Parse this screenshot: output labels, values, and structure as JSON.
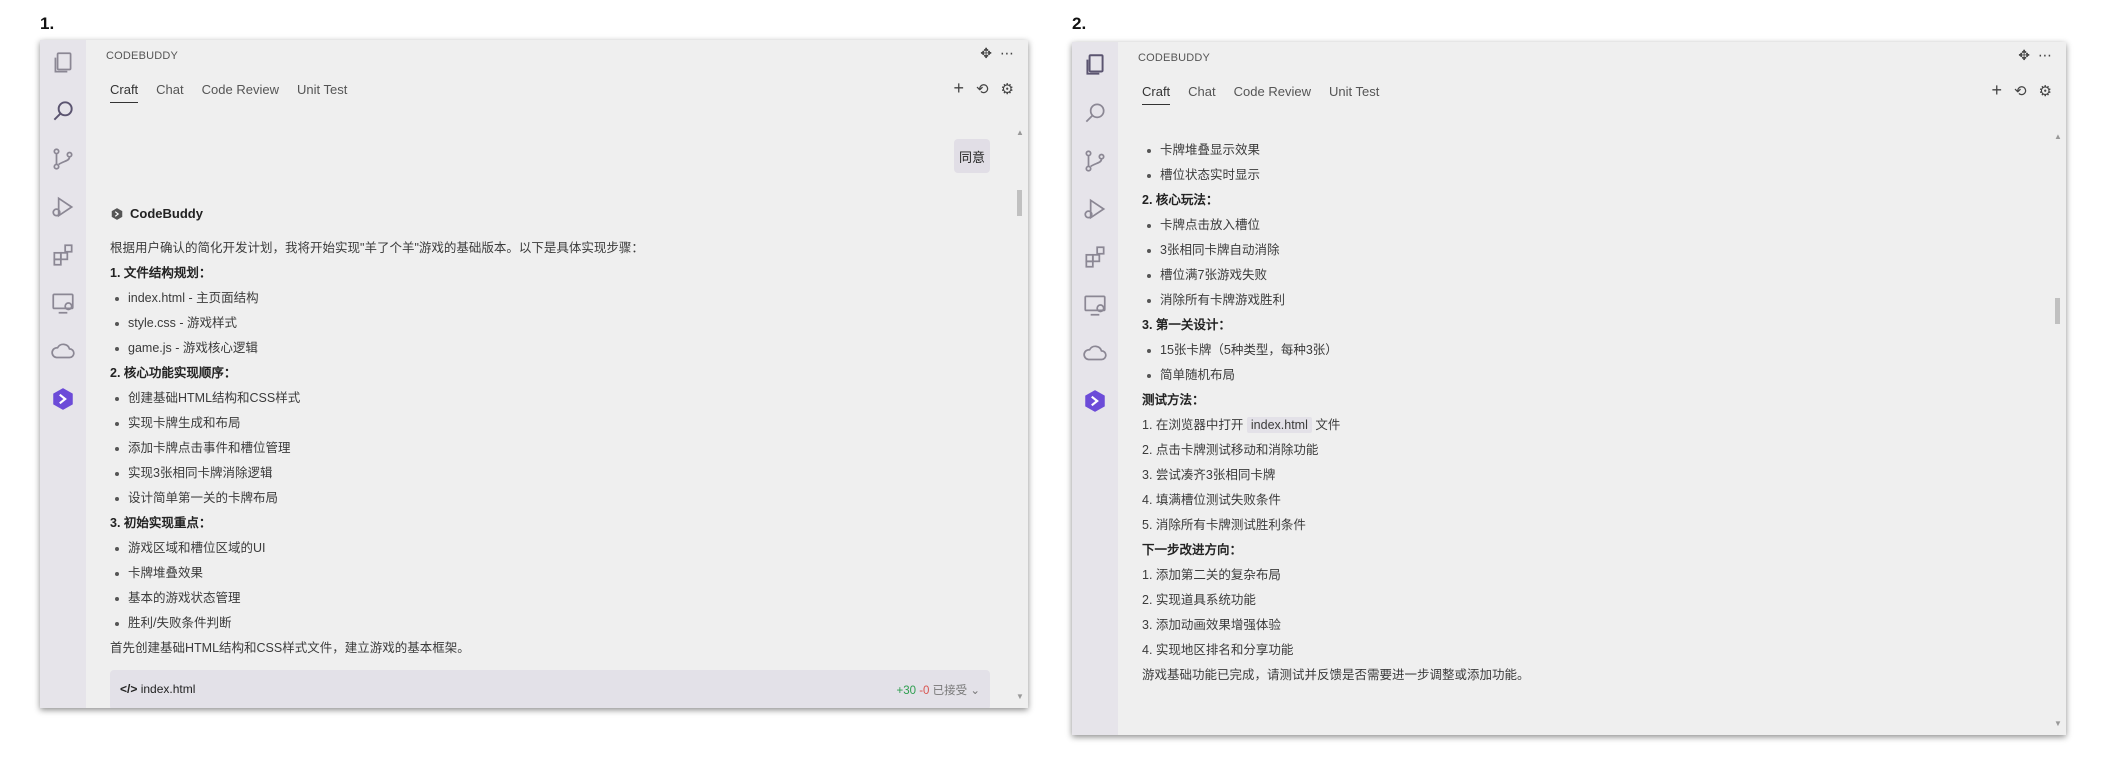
{
  "panels": [
    {
      "number": "1.",
      "app_header": "CODEBUDDY",
      "tabs": [
        "Craft",
        "Chat",
        "Code Review",
        "Unit Test"
      ],
      "active_tab": "Craft",
      "user_reply_button": "同意",
      "bot_name": "CodeBuddy",
      "intro": "根据用户确认的简化开发计划，我将开始实现\"羊了个羊\"游戏的基础版本。以下是具体实现步骤：",
      "section1_title": "1. 文件结构规划：",
      "section1_items": [
        "index.html - 主页面结构",
        "style.css - 游戏样式",
        "game.js - 游戏核心逻辑"
      ],
      "section2_title": "2. 核心功能实现顺序：",
      "section2_items": [
        "创建基础HTML结构和CSS样式",
        "实现卡牌生成和布局",
        "添加卡牌点击事件和槽位管理",
        "实现3张相同卡牌消除逻辑",
        "设计简单第一关的卡牌布局"
      ],
      "section3_title": "3. 初始实现重点：",
      "section3_items": [
        "游戏区域和槽位区域的UI",
        "卡牌堆叠效果",
        "基本的游戏状态管理",
        "胜利/失败条件判断"
      ],
      "closing": "首先创建基础HTML结构和CSS样式文件，建立游戏的基本框架。",
      "code_file": "index.html",
      "code_added": "+30",
      "code_removed": "-0",
      "code_status": "已接受"
    },
    {
      "number": "2.",
      "app_header": "CODEBUDDY",
      "tabs": [
        "Craft",
        "Chat",
        "Code Review",
        "Unit Test"
      ],
      "active_tab": "Craft",
      "top_items": [
        "卡牌堆叠显示效果",
        "槽位状态实时显示"
      ],
      "core_title": "2. 核心玩法：",
      "core_items": [
        "卡牌点击放入槽位",
        "3张相同卡牌自动消除",
        "槽位满7张游戏失败",
        "消除所有卡牌游戏胜利"
      ],
      "level_title": "3. 第一关设计：",
      "level_items": [
        "15张卡牌（5种类型，每种3张）",
        "简单随机布局"
      ],
      "test_title": "测试方法：",
      "test_step1_prefix": "1. 在浏览器中打开",
      "test_step1_code": "index.html",
      "test_step1_suffix": "文件",
      "test_steps": [
        "2. 点击卡牌测试移动和消除功能",
        "3. 尝试凑齐3张相同卡牌",
        "4. 填满槽位测试失败条件",
        "5. 消除所有卡牌测试胜利条件"
      ],
      "next_title": "下一步改进方向：",
      "next_steps": [
        "1. 添加第二关的复杂布局",
        "2. 实现道具系统功能",
        "3. 添加动画效果增强体验",
        "4. 实现地区排名和分享功能"
      ],
      "closing": "游戏基础功能已完成，请测试并反馈是否需要进一步调整或添加功能。"
    }
  ],
  "icons": [
    "files-icon",
    "search-icon",
    "source-control-icon",
    "run-debug-icon",
    "extensions-icon",
    "remote-explorer-icon",
    "cloud-icon",
    "codebuddy-logo-icon",
    "move-icon",
    "more-icon",
    "add-icon",
    "history-icon",
    "settings-icon"
  ]
}
